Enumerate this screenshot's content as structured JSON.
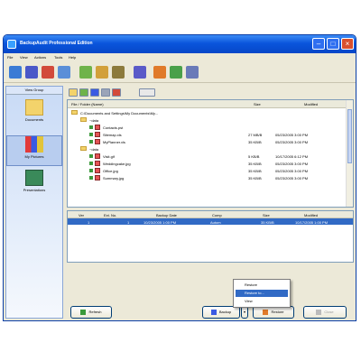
{
  "window": {
    "title": "BackupAudit Professional Edition"
  },
  "menu": [
    "File",
    "View",
    "Actions",
    "Tools",
    "Help"
  ],
  "sidebar": {
    "header": "View Group",
    "items": [
      {
        "label": "Documents"
      },
      {
        "label": "My Pictures"
      },
      {
        "label": "Presentations"
      }
    ]
  },
  "tree": {
    "columns": [
      "File / Folder (Name)",
      "Size",
      "Modified"
    ],
    "root": "C:\\Documents and Settings\\My Documents\\My...",
    "rows": [
      {
        "name": "~data",
        "size": "",
        "modified": ""
      },
      {
        "name": "Contacts.pst",
        "size": "",
        "modified": ""
      },
      {
        "name": "Sitemap.xls",
        "size": "27 MB/B",
        "modified": "05/23/2005 3:00 PM"
      },
      {
        "name": "MyPlanner.xls",
        "size": "35 KB/B",
        "modified": "05/23/2005 3:00 PM"
      },
      {
        "name": "~data",
        "size": "",
        "modified": ""
      },
      {
        "name": "Visit.gif",
        "size": "5 KB/B",
        "modified": "10/17/2005 6:12 PM"
      },
      {
        "name": "Weddingcake.jpg",
        "size": "35 KB/B",
        "modified": "05/23/2005 3:00 PM"
      },
      {
        "name": "Office.jpg",
        "size": "35 KB/B",
        "modified": "05/23/2005 3:00 PM"
      },
      {
        "name": "Summary.jpg",
        "size": "35 KB/B",
        "modified": "05/23/2005 3:00 PM"
      }
    ]
  },
  "history": {
    "columns": [
      "Ver",
      "Ext. No.",
      "Backup Date",
      "Comp",
      "Size",
      "Modified"
    ],
    "selected": {
      "ver": "1",
      "ext": "1",
      "date": "10/23/2005 1:00 PM",
      "comp": "Autom",
      "size": "35 KB/B",
      "modified": "10/17/2005 1:00 PM"
    }
  },
  "context_menu": [
    "Restore",
    "Restore to...",
    "View"
  ],
  "buttons": {
    "refresh": "Refresh",
    "backup": "Backup",
    "restore": "Restore",
    "close": "Close"
  },
  "colors": {
    "titlebar": "#0a55dc",
    "selection": "#316ac5",
    "window_bg": "#ece9d8"
  }
}
